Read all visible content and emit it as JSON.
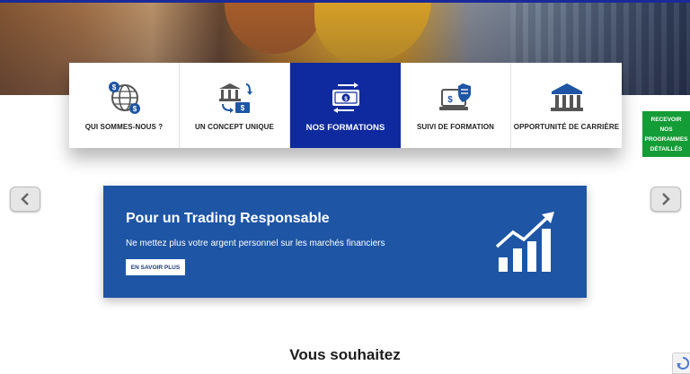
{
  "menu": {
    "items": [
      {
        "label": "QUI SOMMES-NOUS ?",
        "icon": "globe-dollar-icon"
      },
      {
        "label": "UN CONCEPT UNIQUE",
        "icon": "bank-exchange-icon"
      },
      {
        "label": "NOS FORMATIONS",
        "icon": "money-transfer-icon",
        "active": true
      },
      {
        "label": "SUIVI DE FORMATION",
        "icon": "laptop-shield-icon"
      },
      {
        "label": "OPPORTUNITÉ DE CARRIÈRE",
        "icon": "bank-building-icon"
      }
    ]
  },
  "cta": {
    "line1": "RECEVOIR",
    "line2": "NOS",
    "line3": "PROGRAMMES",
    "line4": "DÉTAILLÉS"
  },
  "carousel": {
    "title": "Pour un Trading Responsable",
    "subtitle": "Ne mettez plus votre argent personnel sur les marchés financiers",
    "button_label": "EN SAVOIR PLUS",
    "prev_icon": "chevron-left-icon",
    "next_icon": "chevron-right-icon"
  },
  "section": {
    "title": "Vous souhaitez"
  },
  "colors": {
    "active_menu": "#0f2a9e",
    "banner": "#1e55a5",
    "cta_green": "#149c36",
    "icon_blue": "#1e55a5"
  }
}
